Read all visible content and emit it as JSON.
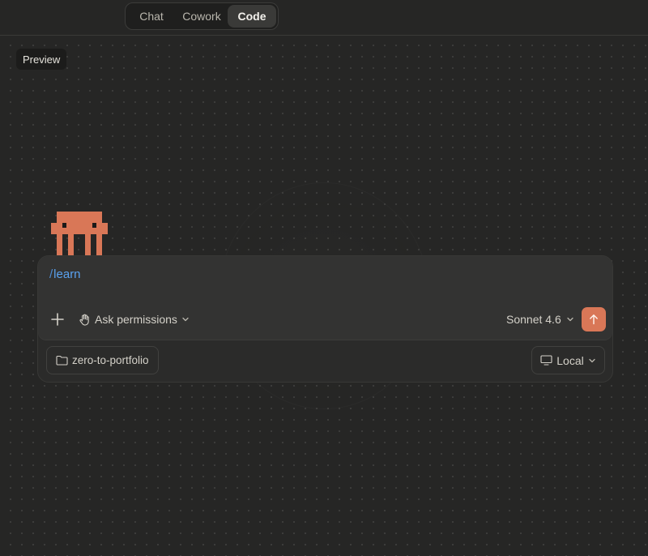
{
  "header": {
    "tabs": [
      {
        "label": "Chat",
        "active": false
      },
      {
        "label": "Cowork",
        "active": false
      },
      {
        "label": "Code",
        "active": true
      }
    ]
  },
  "canvas": {
    "preview_label": "Preview",
    "mascot_icon": "pixel-crab-mascot",
    "mascot_color": "#d97757"
  },
  "composer": {
    "input_prefix": "/",
    "input_value": "learn",
    "add_icon": "plus-icon",
    "permissions_icon": "hand-icon",
    "permissions_label": "Ask permissions",
    "model_label": "Sonnet 4.6",
    "send_icon": "arrow-up-icon",
    "send_color": "#d97757",
    "folder_icon": "folder-icon",
    "folder_label": "zero-to-portfolio",
    "environment_icon": "monitor-icon",
    "environment_label": "Local"
  },
  "colors": {
    "background": "#262625",
    "accent": "#d97757",
    "command_text": "#5aa2f0"
  }
}
